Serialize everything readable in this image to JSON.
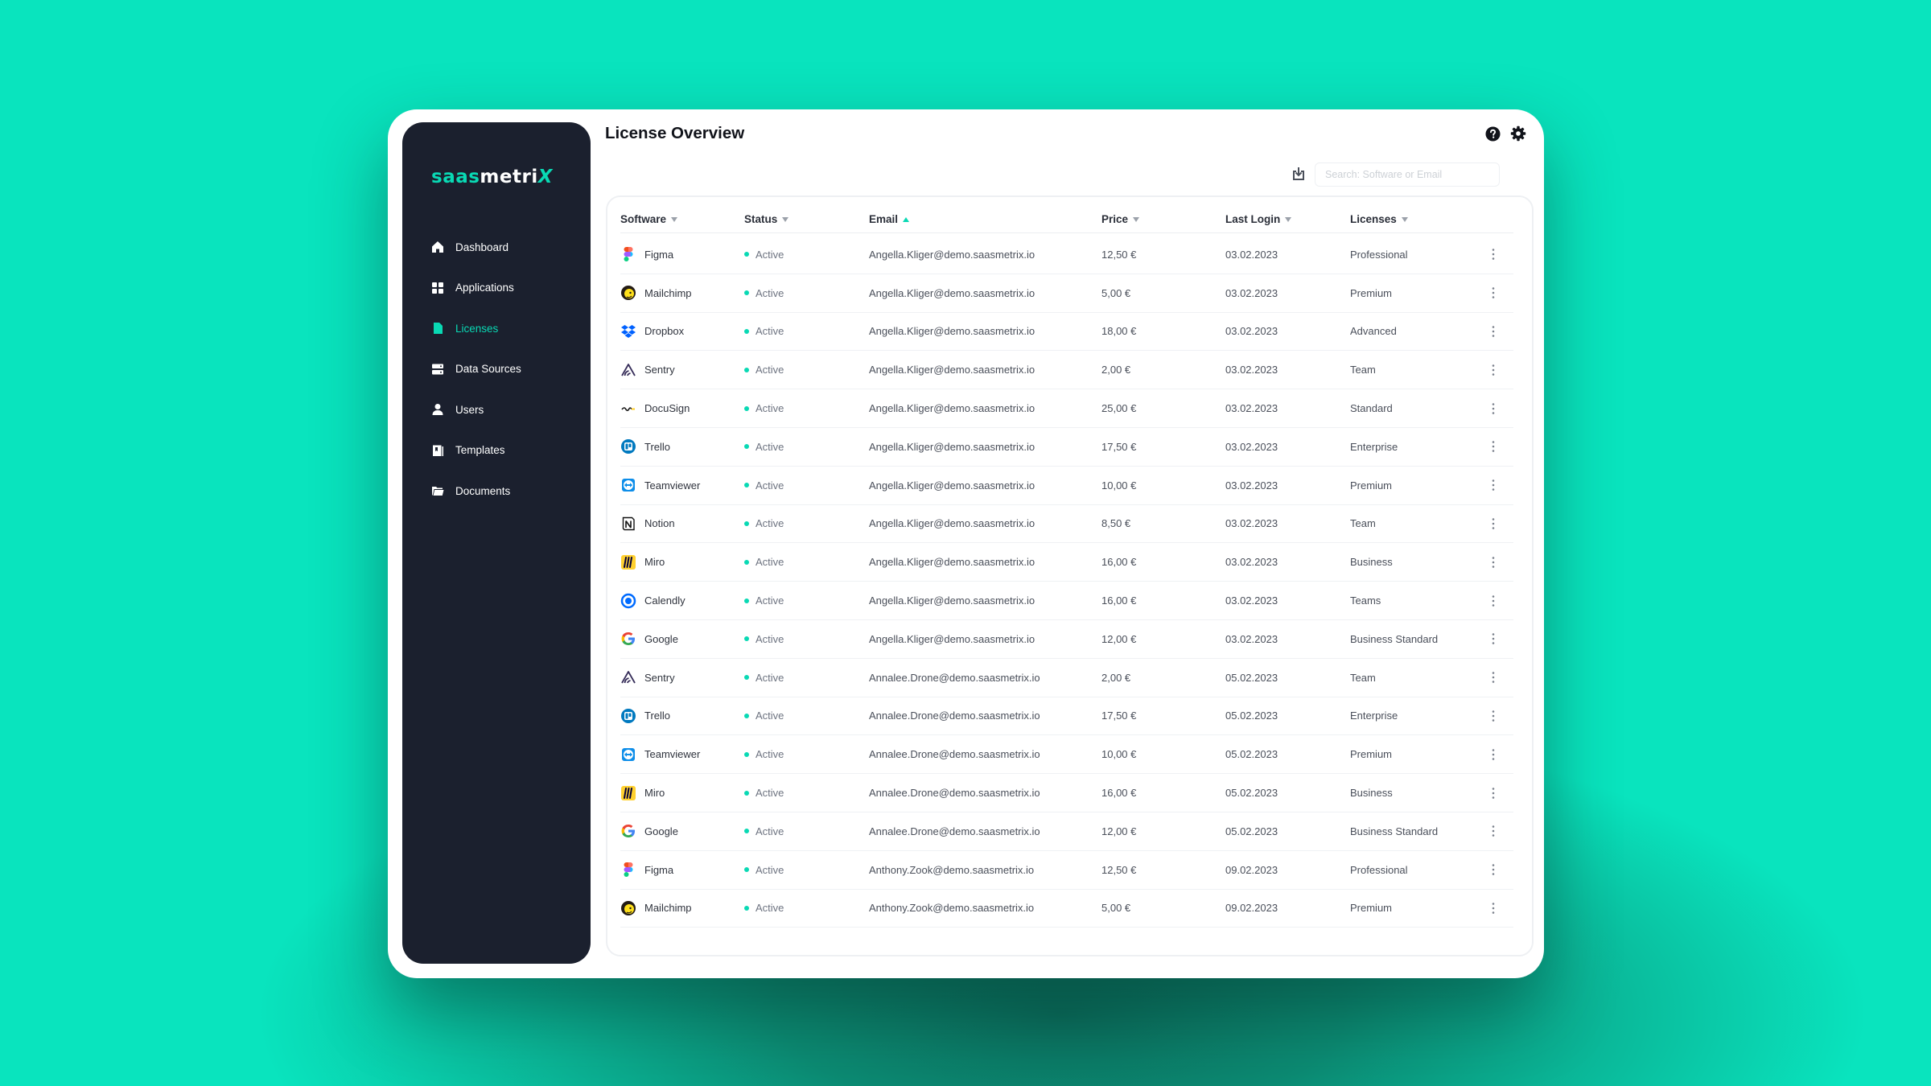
{
  "app": {
    "logo": {
      "part1": "saas",
      "part2": "metri",
      "part3": "X"
    },
    "colors": {
      "accent": "#09d9b4",
      "sidebar": "#1b202e",
      "background": "#09e4be"
    }
  },
  "sidebar": {
    "items": [
      {
        "label": "Dashboard",
        "icon": "home-icon",
        "active": false
      },
      {
        "label": "Applications",
        "icon": "grid-icon",
        "active": false
      },
      {
        "label": "Licenses",
        "icon": "document-icon",
        "active": true
      },
      {
        "label": "Data Sources",
        "icon": "server-icon",
        "active": false
      },
      {
        "label": "Users",
        "icon": "user-icon",
        "active": false
      },
      {
        "label": "Templates",
        "icon": "book-icon",
        "active": false
      },
      {
        "label": "Documents",
        "icon": "folder-icon",
        "active": false
      }
    ]
  },
  "header": {
    "title": "License Overview",
    "icons": [
      "help-icon",
      "gear-icon"
    ]
  },
  "toolbar": {
    "export_icon": "export-icon",
    "search_placeholder": "Search: Software or Email"
  },
  "table": {
    "columns": [
      {
        "label": "Software",
        "sort": "down"
      },
      {
        "label": "Status",
        "sort": "down"
      },
      {
        "label": "Email",
        "sort": "up"
      },
      {
        "label": "Price",
        "sort": "down"
      },
      {
        "label": "Last Login",
        "sort": "down"
      },
      {
        "label": "Licenses",
        "sort": "down"
      }
    ],
    "rows": [
      {
        "software": "Figma",
        "icon": "figma-icon",
        "status": "Active",
        "email": "Angella.Kliger@demo.saasmetrix.io",
        "price": "12,50 €",
        "last_login": "03.02.2023",
        "license": "Professional"
      },
      {
        "software": "Mailchimp",
        "icon": "mailchimp-icon",
        "status": "Active",
        "email": "Angella.Kliger@demo.saasmetrix.io",
        "price": "5,00 €",
        "last_login": "03.02.2023",
        "license": "Premium"
      },
      {
        "software": "Dropbox",
        "icon": "dropbox-icon",
        "status": "Active",
        "email": "Angella.Kliger@demo.saasmetrix.io",
        "price": "18,00 €",
        "last_login": "03.02.2023",
        "license": "Advanced"
      },
      {
        "software": "Sentry",
        "icon": "sentry-icon",
        "status": "Active",
        "email": "Angella.Kliger@demo.saasmetrix.io",
        "price": "2,00 €",
        "last_login": "03.02.2023",
        "license": "Team"
      },
      {
        "software": "DocuSign",
        "icon": "docusign-icon",
        "status": "Active",
        "email": "Angella.Kliger@demo.saasmetrix.io",
        "price": "25,00 €",
        "last_login": "03.02.2023",
        "license": "Standard"
      },
      {
        "software": "Trello",
        "icon": "trello-icon",
        "status": "Active",
        "email": "Angella.Kliger@demo.saasmetrix.io",
        "price": "17,50 €",
        "last_login": "03.02.2023",
        "license": "Enterprise"
      },
      {
        "software": "Teamviewer",
        "icon": "teamviewer-icon",
        "status": "Active",
        "email": "Angella.Kliger@demo.saasmetrix.io",
        "price": "10,00 €",
        "last_login": "03.02.2023",
        "license": "Premium"
      },
      {
        "software": "Notion",
        "icon": "notion-icon",
        "status": "Active",
        "email": "Angella.Kliger@demo.saasmetrix.io",
        "price": "8,50 €",
        "last_login": "03.02.2023",
        "license": "Team"
      },
      {
        "software": "Miro",
        "icon": "miro-icon",
        "status": "Active",
        "email": "Angella.Kliger@demo.saasmetrix.io",
        "price": "16,00 €",
        "last_login": "03.02.2023",
        "license": "Business"
      },
      {
        "software": "Calendly",
        "icon": "calendly-icon",
        "status": "Active",
        "email": "Angella.Kliger@demo.saasmetrix.io",
        "price": "16,00 €",
        "last_login": "03.02.2023",
        "license": "Teams"
      },
      {
        "software": "Google",
        "icon": "google-icon",
        "status": "Active",
        "email": "Angella.Kliger@demo.saasmetrix.io",
        "price": "12,00 €",
        "last_login": "03.02.2023",
        "license": "Business Standard"
      },
      {
        "software": "Sentry",
        "icon": "sentry-icon",
        "status": "Active",
        "email": "Annalee.Drone@demo.saasmetrix.io",
        "price": "2,00 €",
        "last_login": "05.02.2023",
        "license": "Team"
      },
      {
        "software": "Trello",
        "icon": "trello-icon",
        "status": "Active",
        "email": "Annalee.Drone@demo.saasmetrix.io",
        "price": "17,50 €",
        "last_login": "05.02.2023",
        "license": "Enterprise"
      },
      {
        "software": "Teamviewer",
        "icon": "teamviewer-icon",
        "status": "Active",
        "email": "Annalee.Drone@demo.saasmetrix.io",
        "price": "10,00 €",
        "last_login": "05.02.2023",
        "license": "Premium"
      },
      {
        "software": "Miro",
        "icon": "miro-icon",
        "status": "Active",
        "email": "Annalee.Drone@demo.saasmetrix.io",
        "price": "16,00 €",
        "last_login": "05.02.2023",
        "license": "Business"
      },
      {
        "software": "Google",
        "icon": "google-icon",
        "status": "Active",
        "email": "Annalee.Drone@demo.saasmetrix.io",
        "price": "12,00 €",
        "last_login": "05.02.2023",
        "license": "Business Standard"
      },
      {
        "software": "Figma",
        "icon": "figma-icon",
        "status": "Active",
        "email": "Anthony.Zook@demo.saasmetrix.io",
        "price": "12,50 €",
        "last_login": "09.02.2023",
        "license": "Professional"
      },
      {
        "software": "Mailchimp",
        "icon": "mailchimp-icon",
        "status": "Active",
        "email": "Anthony.Zook@demo.saasmetrix.io",
        "price": "5,00 €",
        "last_login": "09.02.2023",
        "license": "Premium"
      }
    ]
  }
}
